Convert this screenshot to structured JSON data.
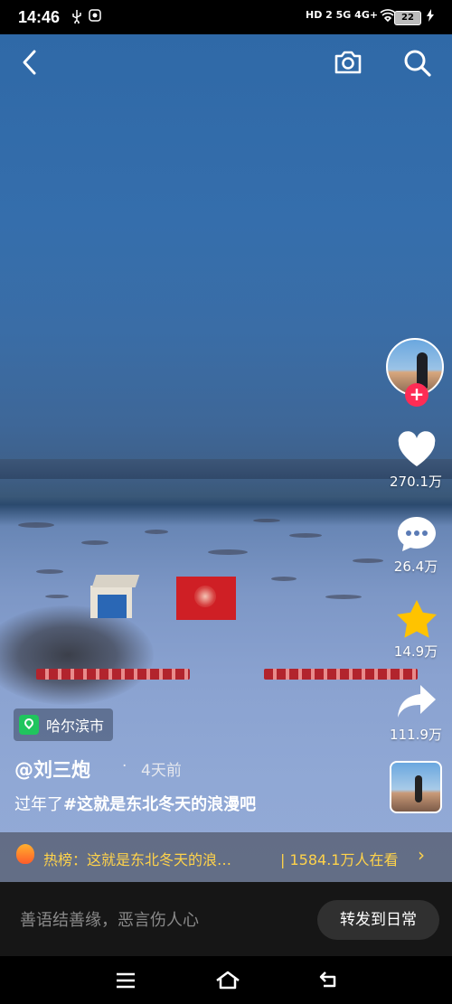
{
  "status_bar": {
    "time": "14:46",
    "network": "HD 2  5G  4G+",
    "battery": "22"
  },
  "top_bar": {
    "back_icon": "back-arrow-icon",
    "camera_icon": "camera-icon",
    "search_icon": "search-icon"
  },
  "actions": {
    "likes": "270.1万",
    "comments": "26.4万",
    "favorites": "14.9万",
    "shares": "111.9万"
  },
  "location": "哈尔滨市",
  "author": "@刘三炮",
  "posted_dot": "·",
  "posted": "4天前",
  "caption": {
    "prefix": "过年了",
    "hashtag": "#这就是东北冬天的浪漫吧"
  },
  "hot": {
    "text": "热榜：这就是东北冬天的浪…",
    "viewers": "| 1584.1万人在看",
    "arrow": "›"
  },
  "comment": {
    "placeholder": "善语结善缘，恶言伤人心",
    "repost_label": "转发到日常"
  },
  "colors": {
    "accent": "#fe2c55",
    "like_fill": "#ffffff",
    "star": "#ffc300",
    "hot_text": "#ffd34a"
  }
}
